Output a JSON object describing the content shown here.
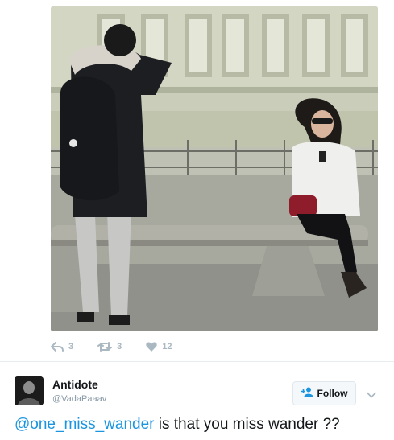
{
  "tweet": {
    "actions": {
      "reply_count": "3",
      "retweet_count": "3",
      "like_count": "12"
    },
    "author": {
      "name": "Antidote",
      "handle": "@VadaPaaav"
    },
    "follow_label": "Follow",
    "text": {
      "mention": "@one_miss_wander",
      "body": " is that you miss wander ??"
    }
  },
  "colors": {
    "link": "#1b95e0",
    "muted": "#aab8c2",
    "handle": "#8899a6"
  },
  "icons": [
    "reply-icon",
    "retweet-icon",
    "heart-icon",
    "follow-user-icon",
    "chevron-down-icon"
  ]
}
